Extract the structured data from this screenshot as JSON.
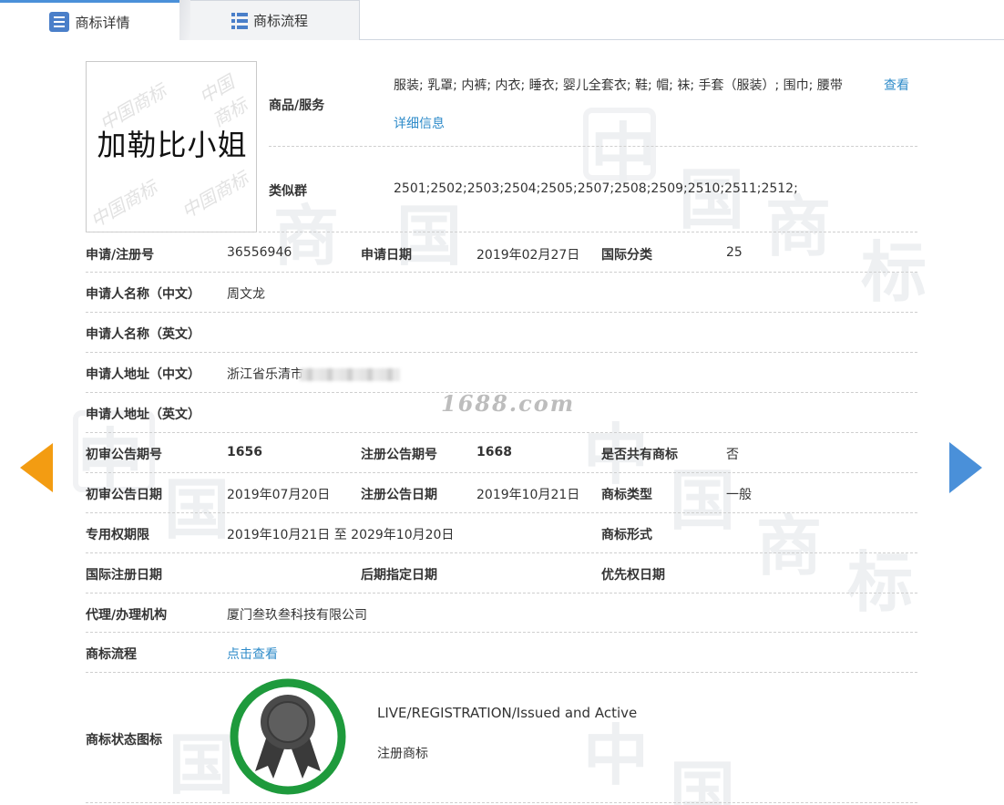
{
  "tabs": [
    {
      "label": "商标详情",
      "active": true
    },
    {
      "label": "商标流程",
      "active": false
    }
  ],
  "logo": {
    "text": "加勒比小姐",
    "watermark": "中国商标"
  },
  "goods": {
    "label": "商品/服务",
    "value": "服装; 乳罩; 内裤; 内衣; 睡衣; 婴儿全套衣; 鞋; 帽; 袜; 手套（服装）; 围巾; 腰带",
    "more_link": "查看详细信息"
  },
  "similar": {
    "label": "类似群",
    "value": "2501;2502;2503;2504;2505;2507;2508;2509;2510;2511;2512;"
  },
  "fields": {
    "reg_no_label": "申请/注册号",
    "reg_no": "36556946",
    "apply_date_label": "申请日期",
    "apply_date": "2019年02月27日",
    "intl_class_label": "国际分类",
    "intl_class": "25",
    "applicant_cn_label": "申请人名称（中文）",
    "applicant_cn": "周文龙",
    "applicant_en_label": "申请人名称（英文）",
    "applicant_en": "",
    "address_cn_label": "申请人地址（中文）",
    "address_cn": "浙江省乐清市",
    "address_en_label": "申请人地址（英文）",
    "address_en": "",
    "prelim_no_label": "初审公告期号",
    "prelim_no": "1656",
    "reg_pub_no_label": "注册公告期号",
    "reg_pub_no": "1668",
    "shared_label": "是否共有商标",
    "shared": "否",
    "prelim_date_label": "初审公告日期",
    "prelim_date": "2019年07月20日",
    "reg_pub_date_label": "注册公告日期",
    "reg_pub_date": "2019年10月21日",
    "type_label": "商标类型",
    "type": "一般",
    "term_label": "专用权期限",
    "term": "2019年10月21日 至 2029年10月20日",
    "form_label": "商标形式",
    "form": "",
    "intl_reg_date_label": "国际注册日期",
    "intl_reg_date": "",
    "later_date_label": "后期指定日期",
    "later_date": "",
    "priority_label": "优先权日期",
    "priority": "",
    "agent_label": "代理/办理机构",
    "agent": "厦门叁玖叁科技有限公司",
    "process_label": "商标流程",
    "process_link": "点击查看",
    "status_icon_label": "商标状态图标",
    "status_en": "LIVE/REGISTRATION/Issued and Active",
    "status_cn": "注册商标"
  },
  "watermark_site": "1688.com",
  "background_watermark_chars": [
    "中",
    "国",
    "商",
    "标"
  ],
  "colors": {
    "link": "#2e8bc9",
    "tab_accent": "#4a90d9",
    "prev_arrow": "#f39c12",
    "next_arrow": "#4a90d9",
    "status_ring": "#1e9a3c"
  },
  "icons": {
    "tab_detail": "list-icon",
    "tab_process": "grid-list-icon",
    "prev": "prev-arrow-icon",
    "next": "next-arrow-icon",
    "status": "rosette-badge-icon"
  }
}
